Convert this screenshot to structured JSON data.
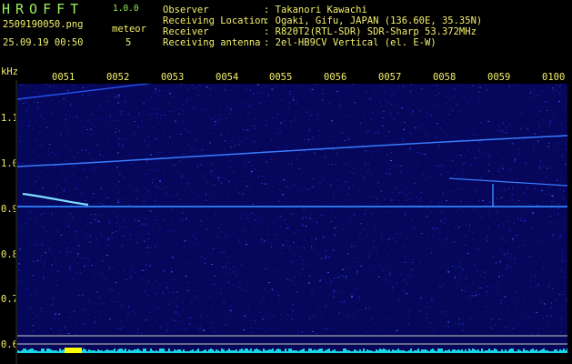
{
  "header": {
    "brand": "HROFFT",
    "version": "1.0.0",
    "filename": "2509190050.png",
    "datetime": "25.09.19 00:50",
    "meteor_label": "meteor",
    "meteor_count": "5",
    "info_labels": [
      "Observer",
      "Receiving Location",
      "Receiver",
      "Receiving antenna"
    ],
    "info_values": [
      ": Takanori Kawachi",
      ": Ogaki, Gifu, JAPAN (136.60E, 35.35N)",
      ": R820T2(RTL-SDR) SDR-Sharp 53.372MHz",
      ": 2el-HB9CV Vertical (el. E-W)"
    ]
  },
  "axis": {
    "y_unit": "kHz",
    "x_ticks": [
      "0051",
      "0052",
      "0053",
      "0054",
      "0055",
      "0056",
      "0057",
      "0058",
      "0059",
      "0100"
    ],
    "y_ticks": [
      "1.1",
      "1.0",
      "0.9",
      "0.8",
      "0.7",
      "0.6"
    ]
  },
  "colors": {
    "background": "#06065a",
    "noise": "#1a2cff",
    "trace": "#4aa8ff",
    "label_yellow": "#f3f06c",
    "label_green": "#9cf05a",
    "baseline": "#19d6e6",
    "burst": "#ffff00"
  }
}
